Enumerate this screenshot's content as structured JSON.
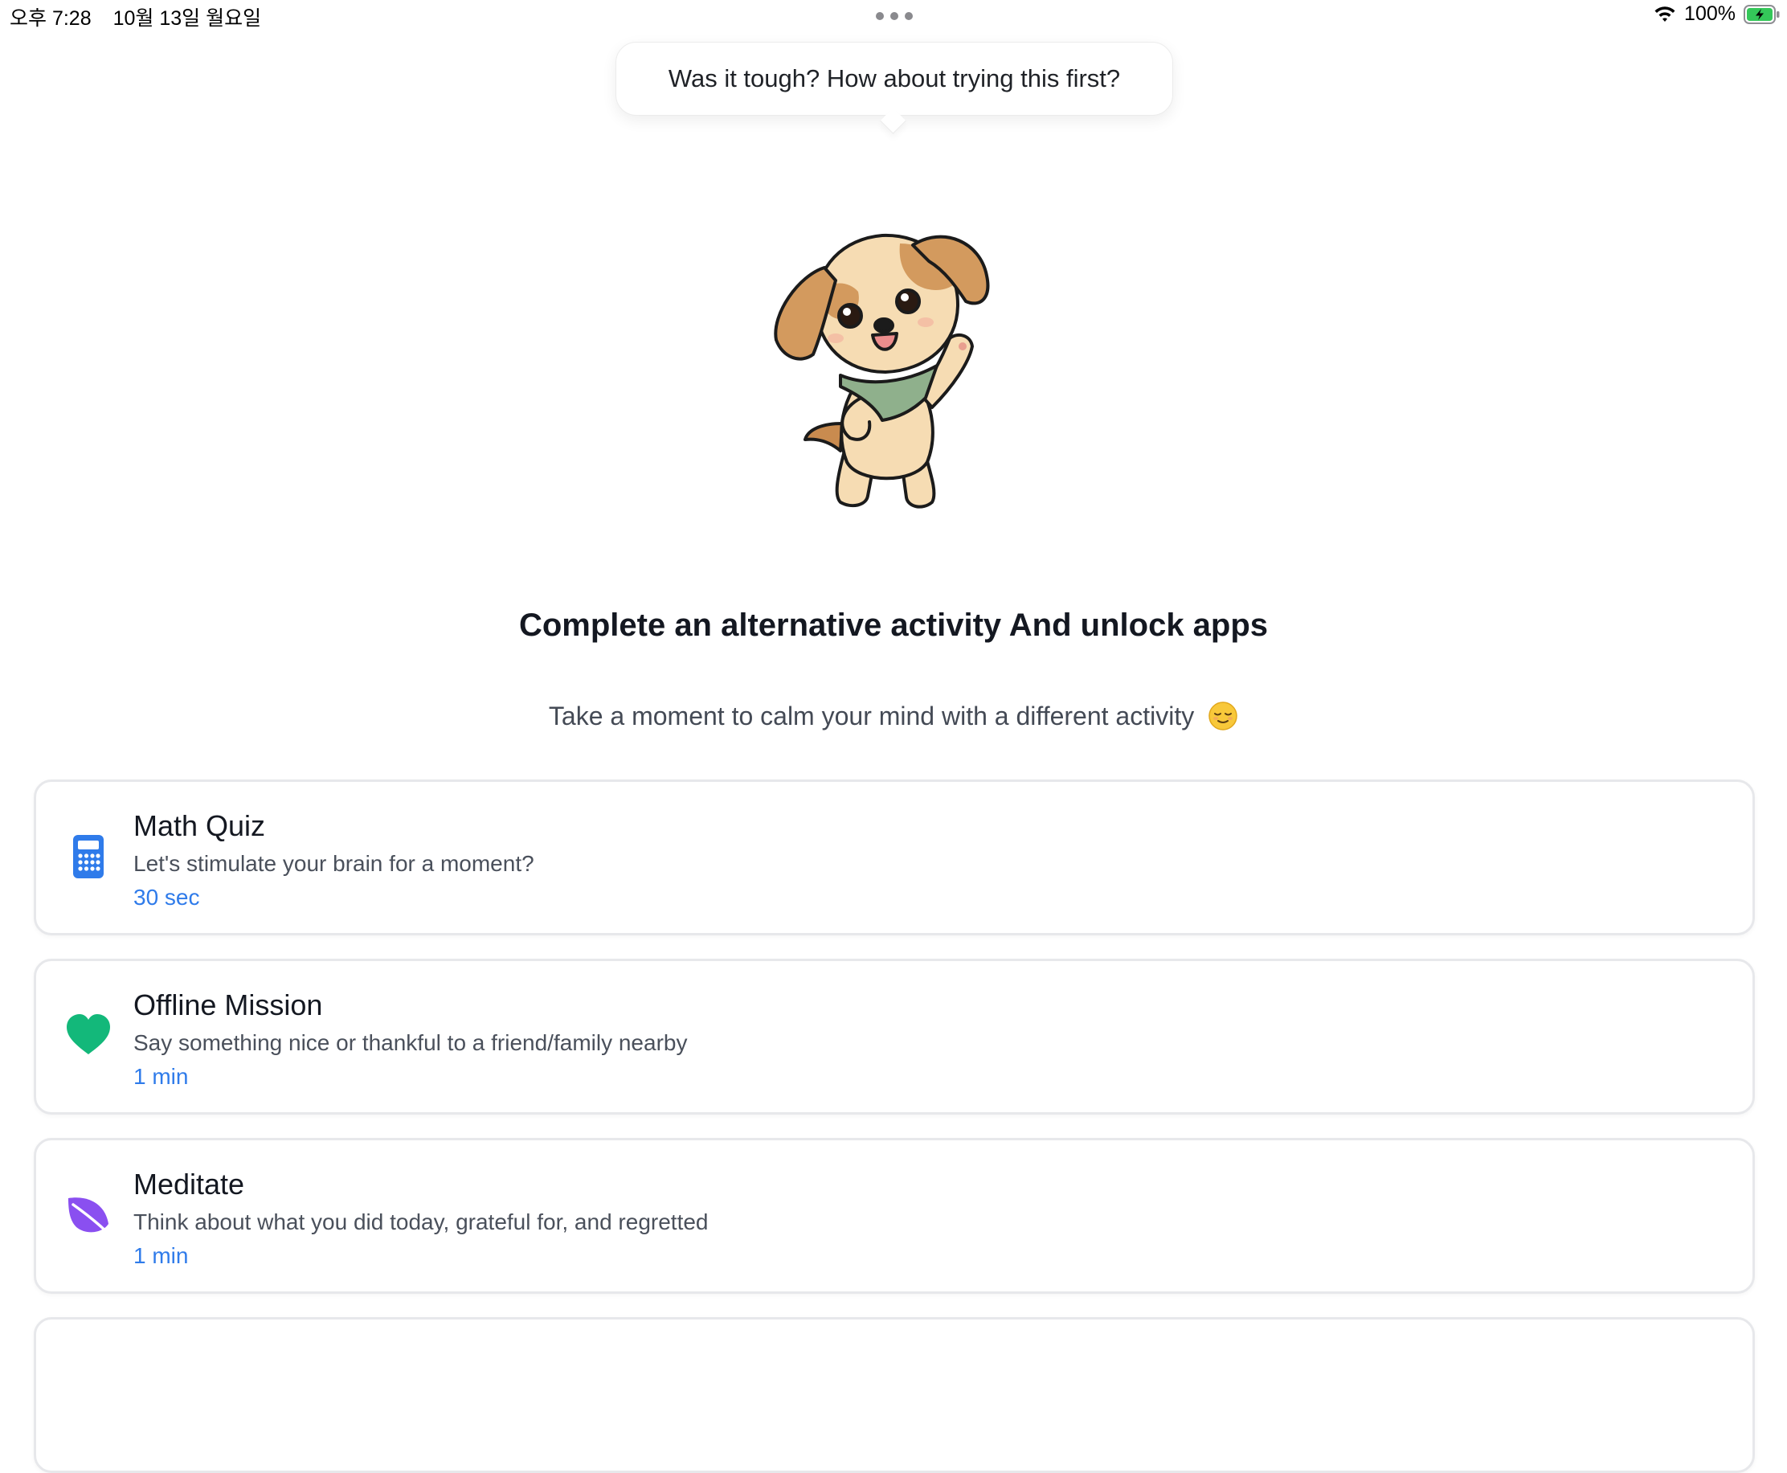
{
  "status_bar": {
    "time": "오후 7:28",
    "date": "10월 13일 월요일",
    "battery_percent": "100%",
    "icons": [
      "multitasking-dots-icon",
      "wifi-icon",
      "battery-charging-icon"
    ]
  },
  "bubble": {
    "text": "Was it tough? How about trying this first?"
  },
  "mascot": {
    "icon": "puppy-mascot-icon"
  },
  "headline": "Complete an alternative activity And unlock apps",
  "subtext": "Take a moment to calm your mind with a different activity",
  "subtext_emoji": "relieved-face-emoji",
  "activities": [
    {
      "title": "Math Quiz",
      "description": "Let's stimulate your brain for a moment?",
      "duration": "30 sec",
      "icon": "calculator-icon",
      "icon_color": "#2f7bea"
    },
    {
      "title": "Offline Mission",
      "description": "Say something nice or thankful to a friend/family nearby",
      "duration": "1 min",
      "icon": "heart-icon",
      "icon_color": "#13b87a"
    },
    {
      "title": "Meditate",
      "description": "Think about what you did today, grateful for, and regretted",
      "duration": "1 min",
      "icon": "leaf-icon",
      "icon_color": "#8a4ff0"
    }
  ],
  "colors": {
    "accent": "#2f7bea",
    "card_border": "#e7e8eb",
    "text_primary": "#141821",
    "text_secondary": "#4a505b"
  }
}
